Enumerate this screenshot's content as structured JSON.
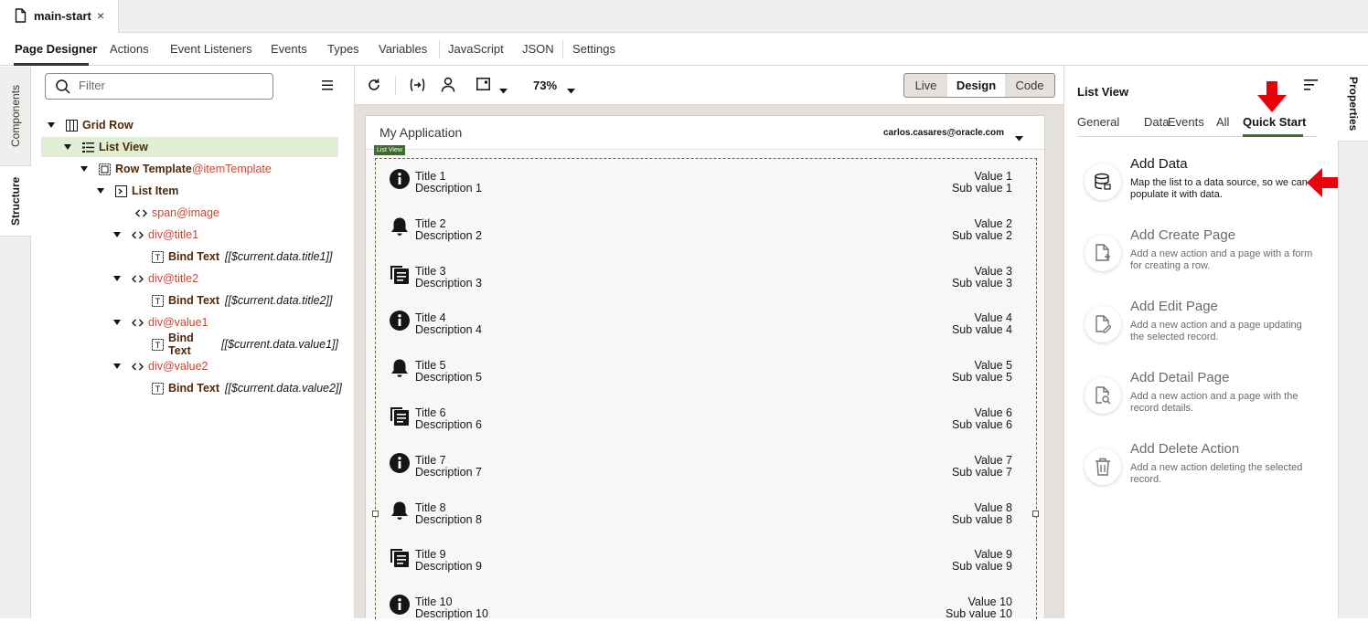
{
  "file_tab": {
    "name": "main-start",
    "close": "×"
  },
  "designer_tabs": [
    "Page Designer",
    "Actions",
    "Event Listeners",
    "Events",
    "Types",
    "Variables",
    "JavaScript",
    "JSON",
    "Settings"
  ],
  "left_rail": {
    "components": "Components",
    "structure": "Structure"
  },
  "structure": {
    "filter_placeholder": "Filter",
    "tree": [
      {
        "label": "Grid Row",
        "attr": "",
        "bind": "",
        "depth": 0
      },
      {
        "label": "List View",
        "attr": "",
        "bind": "",
        "depth": 1
      },
      {
        "label": "Row Template",
        "attr": "@itemTemplate",
        "bind": "",
        "depth": 2
      },
      {
        "label": "List Item",
        "attr": "",
        "bind": "",
        "depth": 3
      },
      {
        "label": "span",
        "attr": "@image",
        "bind": "",
        "depth": 4
      },
      {
        "label": "div",
        "attr": "@title1",
        "bind": "",
        "depth": 4
      },
      {
        "label": "Bind Text",
        "attr": "",
        "bind": "[[$current.data.title1]]",
        "depth": 5
      },
      {
        "label": "div",
        "attr": "@title2",
        "bind": "",
        "depth": 4
      },
      {
        "label": "Bind Text",
        "attr": "",
        "bind": "[[$current.data.title2]]",
        "depth": 5
      },
      {
        "label": "div",
        "attr": "@value1",
        "bind": "",
        "depth": 4
      },
      {
        "label": "Bind Text",
        "attr": "",
        "bind": "[[$current.data.value1]]",
        "depth": 5
      },
      {
        "label": "div",
        "attr": "@value2",
        "bind": "",
        "depth": 4
      },
      {
        "label": "Bind Text",
        "attr": "",
        "bind": "[[$current.data.value2]]",
        "depth": 5
      }
    ]
  },
  "toolbar": {
    "zoom": "73%",
    "modes": [
      "Live",
      "Design",
      "Code"
    ],
    "active_mode": "Design"
  },
  "canvas": {
    "app_title": "My Application",
    "user": "carlos.casares@oracle.com",
    "list_view_badge": "List View",
    "items": [
      {
        "icon": "info-icon",
        "title": "Title 1",
        "desc": "Description 1",
        "value": "Value 1",
        "sub": "Sub value 1"
      },
      {
        "icon": "bell-icon",
        "title": "Title 2",
        "desc": "Description 2",
        "value": "Value 2",
        "sub": "Sub value 2"
      },
      {
        "icon": "copy-icon",
        "title": "Title 3",
        "desc": "Description 3",
        "value": "Value 3",
        "sub": "Sub value 3"
      },
      {
        "icon": "info-icon",
        "title": "Title 4",
        "desc": "Description 4",
        "value": "Value 4",
        "sub": "Sub value 4"
      },
      {
        "icon": "bell-icon",
        "title": "Title 5",
        "desc": "Description 5",
        "value": "Value 5",
        "sub": "Sub value 5"
      },
      {
        "icon": "copy-icon",
        "title": "Title 6",
        "desc": "Description 6",
        "value": "Value 6",
        "sub": "Sub value 6"
      },
      {
        "icon": "info-icon",
        "title": "Title 7",
        "desc": "Description 7",
        "value": "Value 7",
        "sub": "Sub value 7"
      },
      {
        "icon": "bell-icon",
        "title": "Title 8",
        "desc": "Description 8",
        "value": "Value 8",
        "sub": "Sub value 8"
      },
      {
        "icon": "copy-icon",
        "title": "Title 9",
        "desc": "Description 9",
        "value": "Value 9",
        "sub": "Sub value 9"
      },
      {
        "icon": "info-icon",
        "title": "Title 10",
        "desc": "Description 10",
        "value": "Value 10",
        "sub": "Sub value 10"
      }
    ]
  },
  "properties": {
    "title": "List View",
    "tabs": [
      "General",
      "Data",
      "Events",
      "All",
      "Quick Start"
    ],
    "active_tab": "Quick Start",
    "rail_label": "Properties",
    "quick_start": [
      {
        "icon": "database-icon",
        "title": "Add Data",
        "desc": "Map the list to a data source, so we can populate it with data."
      },
      {
        "icon": "file-add-icon",
        "title": "Add Create Page",
        "desc": "Add a new action and a page with a form for creating a row."
      },
      {
        "icon": "file-edit-icon",
        "title": "Add Edit Page",
        "desc": "Add a new action and a page updating the selected record."
      },
      {
        "icon": "file-search-icon",
        "title": "Add Detail Page",
        "desc": "Add a new action and a page with the record details."
      },
      {
        "icon": "trash-icon",
        "title": "Add Delete Action",
        "desc": "Add a new action deleting the selected record."
      }
    ]
  },
  "colors": {
    "accent_green": "#e0efd4",
    "badge_green": "#3f6c2e",
    "node_orange": "#c74634",
    "annotation_red": "#e8000b"
  }
}
